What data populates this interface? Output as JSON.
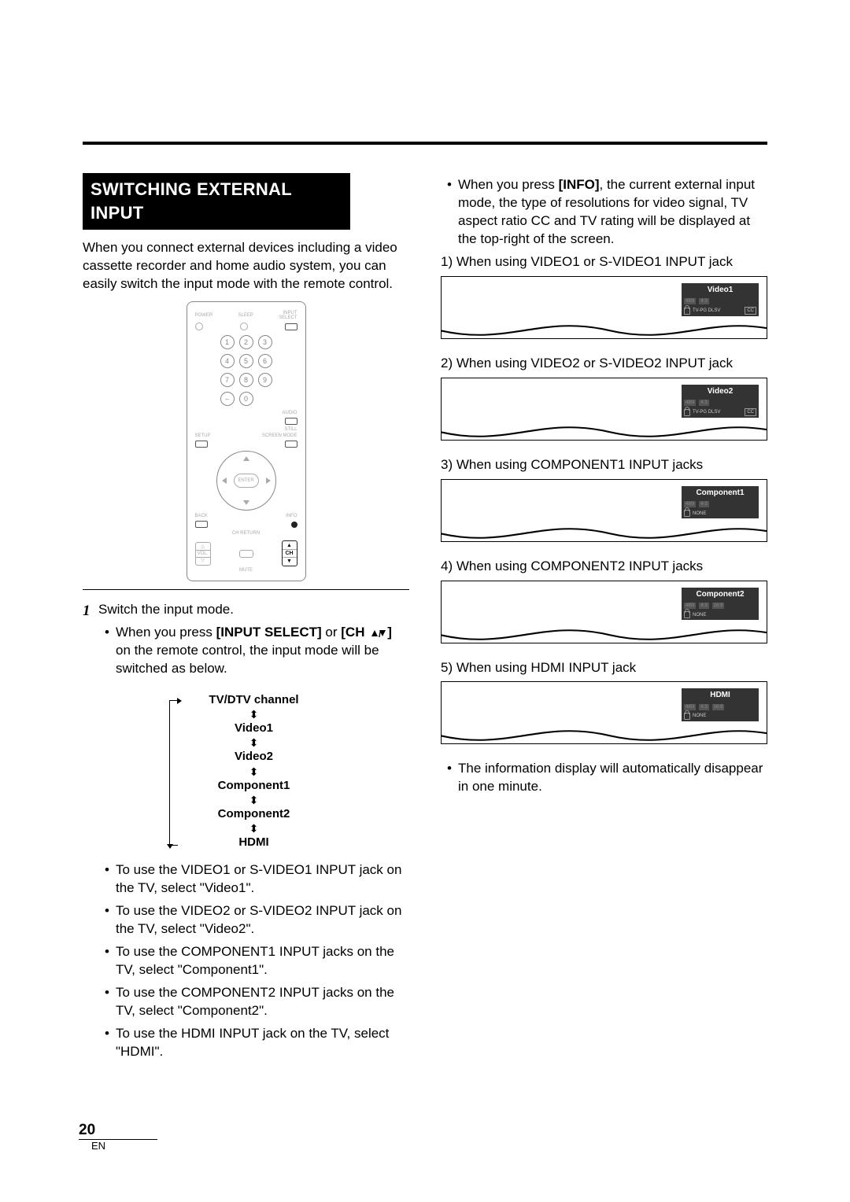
{
  "page": {
    "number": "20",
    "lang": "EN"
  },
  "title": "SWITCHING EXTERNAL INPUT",
  "intro": "When you connect external devices including a video cassette recorder and home audio system, you can easily switch the input mode with the remote control.",
  "remote": {
    "labels": {
      "power": "POWER",
      "sleep": "SLEEP",
      "input_select_top": "INPUT",
      "input_select_bottom": "SELECT",
      "audio": "AUDIO",
      "still": "STILL",
      "setup": "SETUP",
      "screen": "SCREEN MODE",
      "enter": "ENTER",
      "back": "BACK",
      "info": "INFO",
      "ch_return": "CH RETURN",
      "vol": "VOL.",
      "mute": "MUTE",
      "ch": "CH"
    },
    "nums": [
      "1",
      "2",
      "3",
      "4",
      "5",
      "6",
      "7",
      "8",
      "9",
      "–",
      "0"
    ]
  },
  "step1": {
    "num": "1",
    "text": "Switch the input mode.",
    "press_pre": "When you press ",
    "press_b1": "INPUT SELECT",
    "press_mid": " or ",
    "press_b2": "[CH ",
    "press_b2_end": "]",
    "press_post": " on the remote control, the input mode will be switched as below."
  },
  "cycle": [
    "TV/DTV channel",
    "Video1",
    "Video2",
    "Component1",
    "Component2",
    "HDMI"
  ],
  "use_bullets": [
    "To use the VIDEO1 or S-VIDEO1 INPUT jack on the TV, select \"Video1\".",
    "To use the VIDEO2 or S-VIDEO2 INPUT jack on the TV, select \"Video2\".",
    "To use the COMPONENT1 INPUT jacks on the TV, select \"Component1\".",
    "To use the COMPONENT2 INPUT jacks on the TV, select \"Component2\".",
    "To use the HDMI INPUT jack on the TV, select \"HDMI\"."
  ],
  "info_bullet": {
    "pre": "When you press ",
    "b": "INFO",
    "post": ", the current external input mode, the type of resolutions for video signal, TV aspect ratio CC and TV rating will be displayed at the top-right of the screen."
  },
  "cases": [
    {
      "head": "1) When using VIDEO1 or S-VIDEO1 INPUT jack",
      "label": "Video1",
      "row1": [
        "480i",
        "4:3"
      ],
      "row2": "TV-PG DLSV",
      "cc": "CC"
    },
    {
      "head": "2) When using VIDEO2 or S-VIDEO2 INPUT jack",
      "label": "Video2",
      "row1": [
        "480i",
        "4:3"
      ],
      "row2": "TV-PG DLSV",
      "cc": "CC"
    },
    {
      "head": "3) When using COMPONENT1 INPUT jacks",
      "label": "Component1",
      "row1": [
        "480i",
        "4:3"
      ],
      "row2": "NONE",
      "cc": ""
    },
    {
      "head": "4) When using COMPONENT2 INPUT jacks",
      "label": "Component2",
      "row1": [
        "480i",
        "4:3",
        "16:9"
      ],
      "row2": "NONE",
      "cc": ""
    },
    {
      "head": "5) When using HDMI INPUT jack",
      "label": "HDMI",
      "row1": [
        "480i",
        "4:3",
        "16:9"
      ],
      "row2": "NONE",
      "cc": ""
    }
  ],
  "auto_hide": "The information display will automatically disappear in one minute."
}
